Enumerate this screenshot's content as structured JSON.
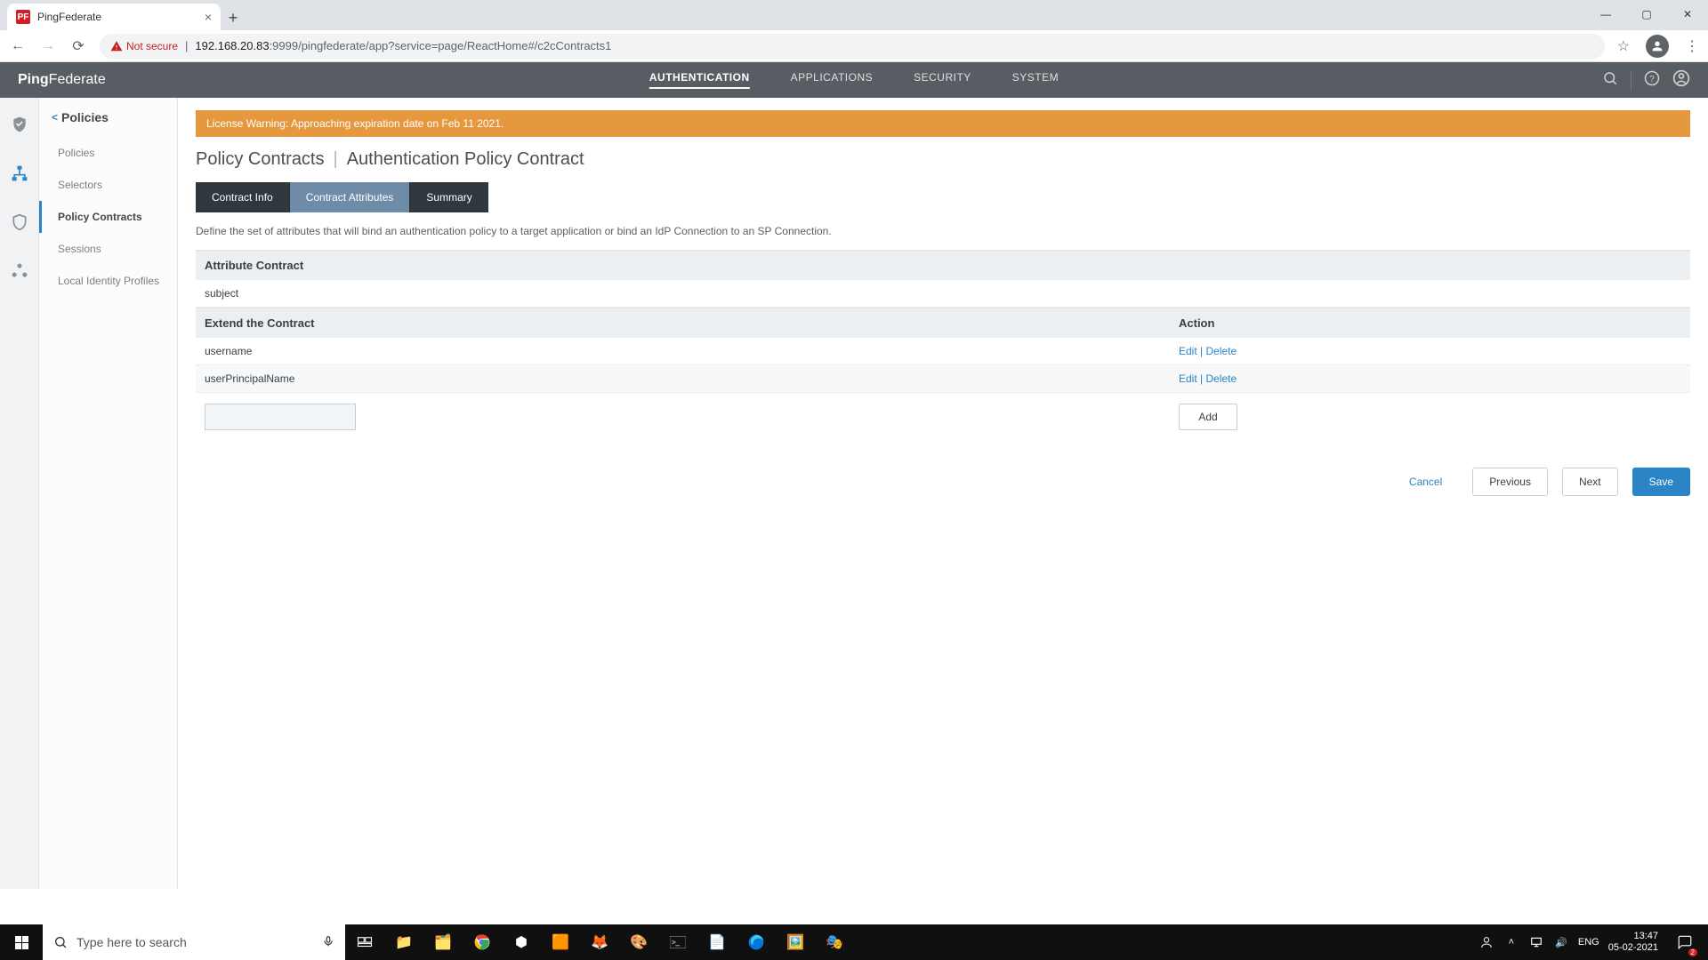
{
  "browser": {
    "tab_title": "PingFederate",
    "favicon": "PF",
    "insecure_label": "Not secure",
    "url_host": "192.168.20.83",
    "url_path": ":9999/pingfederate/app?service=page/ReactHome#/c2cContracts1"
  },
  "header": {
    "logo_bold": "Ping",
    "logo_light": "Federate",
    "nav": {
      "authentication": "AUTHENTICATION",
      "applications": "APPLICATIONS",
      "security": "SECURITY",
      "system": "SYSTEM"
    }
  },
  "sidebar": {
    "title": "Policies",
    "items": [
      {
        "label": "Policies"
      },
      {
        "label": "Selectors"
      },
      {
        "label": "Policy Contracts"
      },
      {
        "label": "Sessions"
      },
      {
        "label": "Local Identity Profiles"
      }
    ]
  },
  "banner": "License Warning: Approaching expiration date on Feb 11 2021.",
  "breadcrumb": {
    "parent": "Policy Contracts",
    "current": "Authentication Policy Contract"
  },
  "tabs": {
    "info": "Contract Info",
    "attrs": "Contract Attributes",
    "summary": "Summary"
  },
  "desc": "Define the set of attributes that will bind an authentication policy to a target application or bind an IdP Connection to an SP Connection.",
  "sections": {
    "attribute_contract": "Attribute Contract",
    "subject": "subject",
    "extend": "Extend the Contract",
    "action": "Action",
    "rows": [
      {
        "name": "username"
      },
      {
        "name": "userPrincipalName"
      }
    ],
    "edit": "Edit",
    "delete": "Delete",
    "add": "Add"
  },
  "buttons": {
    "cancel": "Cancel",
    "previous": "Previous",
    "next": "Next",
    "save": "Save"
  },
  "taskbar": {
    "search_placeholder": "Type here to search",
    "lang": "ENG",
    "time": "13:47",
    "date": "05-02-2021",
    "notif_count": "2"
  }
}
